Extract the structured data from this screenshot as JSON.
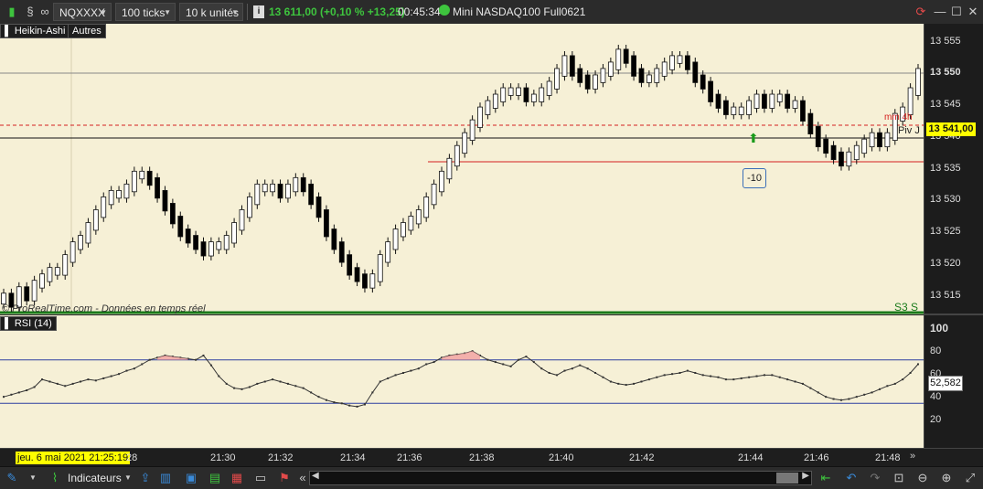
{
  "toolbar": {
    "instrument": "NQXXXX",
    "interval": "100 ticks",
    "units": "10 k unités",
    "info_icon": "i",
    "last_price": "13 611,00 (+0,10 % +13,25)",
    "time": "00:45:34",
    "contract": "Mini NASDAQ100 Full0621"
  },
  "chart": {
    "style_label": "Heikin-Ashi",
    "others_label": "Autres",
    "copyright": "© ProRealTime.com - Données en temps réel",
    "mm_label": "mm 4h",
    "pivot_label": "Piv J",
    "s3_label": "S3 S",
    "current_price": "13 541,00",
    "order_badge": "-10",
    "price_ticks": [
      "13 555",
      "13 550",
      "13 545",
      "13 540",
      "13 535",
      "13 530",
      "13 525",
      "13 520",
      "13 515"
    ]
  },
  "rsi": {
    "title": "RSI (14)",
    "value": "52,582",
    "ticks": [
      "100",
      "80",
      "60",
      "40",
      "20"
    ]
  },
  "xaxis": {
    "cursor_date": "jeu. 6 mai 2021 21:25:19",
    "first_label": "28",
    "labels": [
      "21:30",
      "21:32",
      "21:34",
      "21:36",
      "21:38",
      "21:40",
      "21:42",
      "21:44",
      "21:46",
      "21:48"
    ]
  },
  "bottombar": {
    "indicators_label": "Indicateurs"
  },
  "colors": {
    "chart_bg": "#f6f0d6",
    "bull_candle": "#ffffff",
    "bear_candle": "#000000",
    "current_price_bg": "#ffff00",
    "support_line": "#d42020",
    "s3_line": "#1a7a1a",
    "rsi_line": "#333333",
    "rsi_band": "#2d3fa0"
  },
  "chart_data": {
    "type": "candlestick",
    "y_range": [
      13513,
      13556
    ],
    "price_series": [
      13514,
      13513,
      13515,
      13514,
      13516,
      13517,
      13518,
      13518,
      13520,
      13522,
      13523,
      13525,
      13527,
      13529,
      13530,
      13530,
      13531,
      13533,
      13533,
      13532,
      13530,
      13528,
      13526,
      13524,
      13523,
      13522,
      13521,
      13522,
      13522,
      13523,
      13525,
      13527,
      13529,
      13531,
      13531,
      13531,
      13530,
      13531,
      13532,
      13531,
      13529,
      13527,
      13524,
      13522,
      13520,
      13518,
      13517,
      13516,
      13517,
      13520,
      13522,
      13524,
      13525,
      13526,
      13527,
      13529,
      13531,
      13533,
      13535,
      13537,
      13539,
      13541,
      13543,
      13544,
      13545,
      13546,
      13546,
      13546,
      13545,
      13545,
      13546,
      13547,
      13549,
      13551,
      13549,
      13548,
      13547,
      13548,
      13549,
      13550,
      13552,
      13551,
      13549,
      13548,
      13548,
      13549,
      13550,
      13551,
      13551,
      13550,
      13548,
      13547,
      13545,
      13544,
      13543,
      13543,
      13543,
      13544,
      13545,
      13544,
      13545,
      13545,
      13544,
      13544,
      13542,
      13540,
      13538,
      13537,
      13536,
      13535,
      13536,
      13537,
      13538,
      13539,
      13538,
      13539,
      13542,
      13543,
      13546,
      13549
    ],
    "rsi_series": [
      36,
      38,
      40,
      42,
      45,
      52,
      50,
      48,
      46,
      48,
      50,
      52,
      51,
      53,
      55,
      57,
      60,
      62,
      66,
      70,
      72,
      74,
      73,
      72,
      71,
      70,
      74,
      65,
      55,
      48,
      44,
      43,
      45,
      48,
      50,
      52,
      50,
      48,
      46,
      44,
      40,
      36,
      33,
      31,
      30,
      28,
      27,
      29,
      40,
      50,
      53,
      56,
      58,
      60,
      62,
      66,
      68,
      72,
      74,
      75,
      76,
      78,
      74,
      70,
      68,
      66,
      64,
      70,
      73,
      68,
      62,
      58,
      56,
      60,
      62,
      65,
      62,
      58,
      54,
      50,
      48,
      47,
      48,
      50,
      52,
      54,
      56,
      57,
      58,
      60,
      58,
      56,
      55,
      54,
      52,
      52,
      53,
      54,
      55,
      56,
      56,
      54,
      52,
      50,
      48,
      44,
      40,
      36,
      34,
      33,
      34,
      36,
      38,
      40,
      43,
      46,
      48,
      52,
      58,
      66
    ]
  }
}
